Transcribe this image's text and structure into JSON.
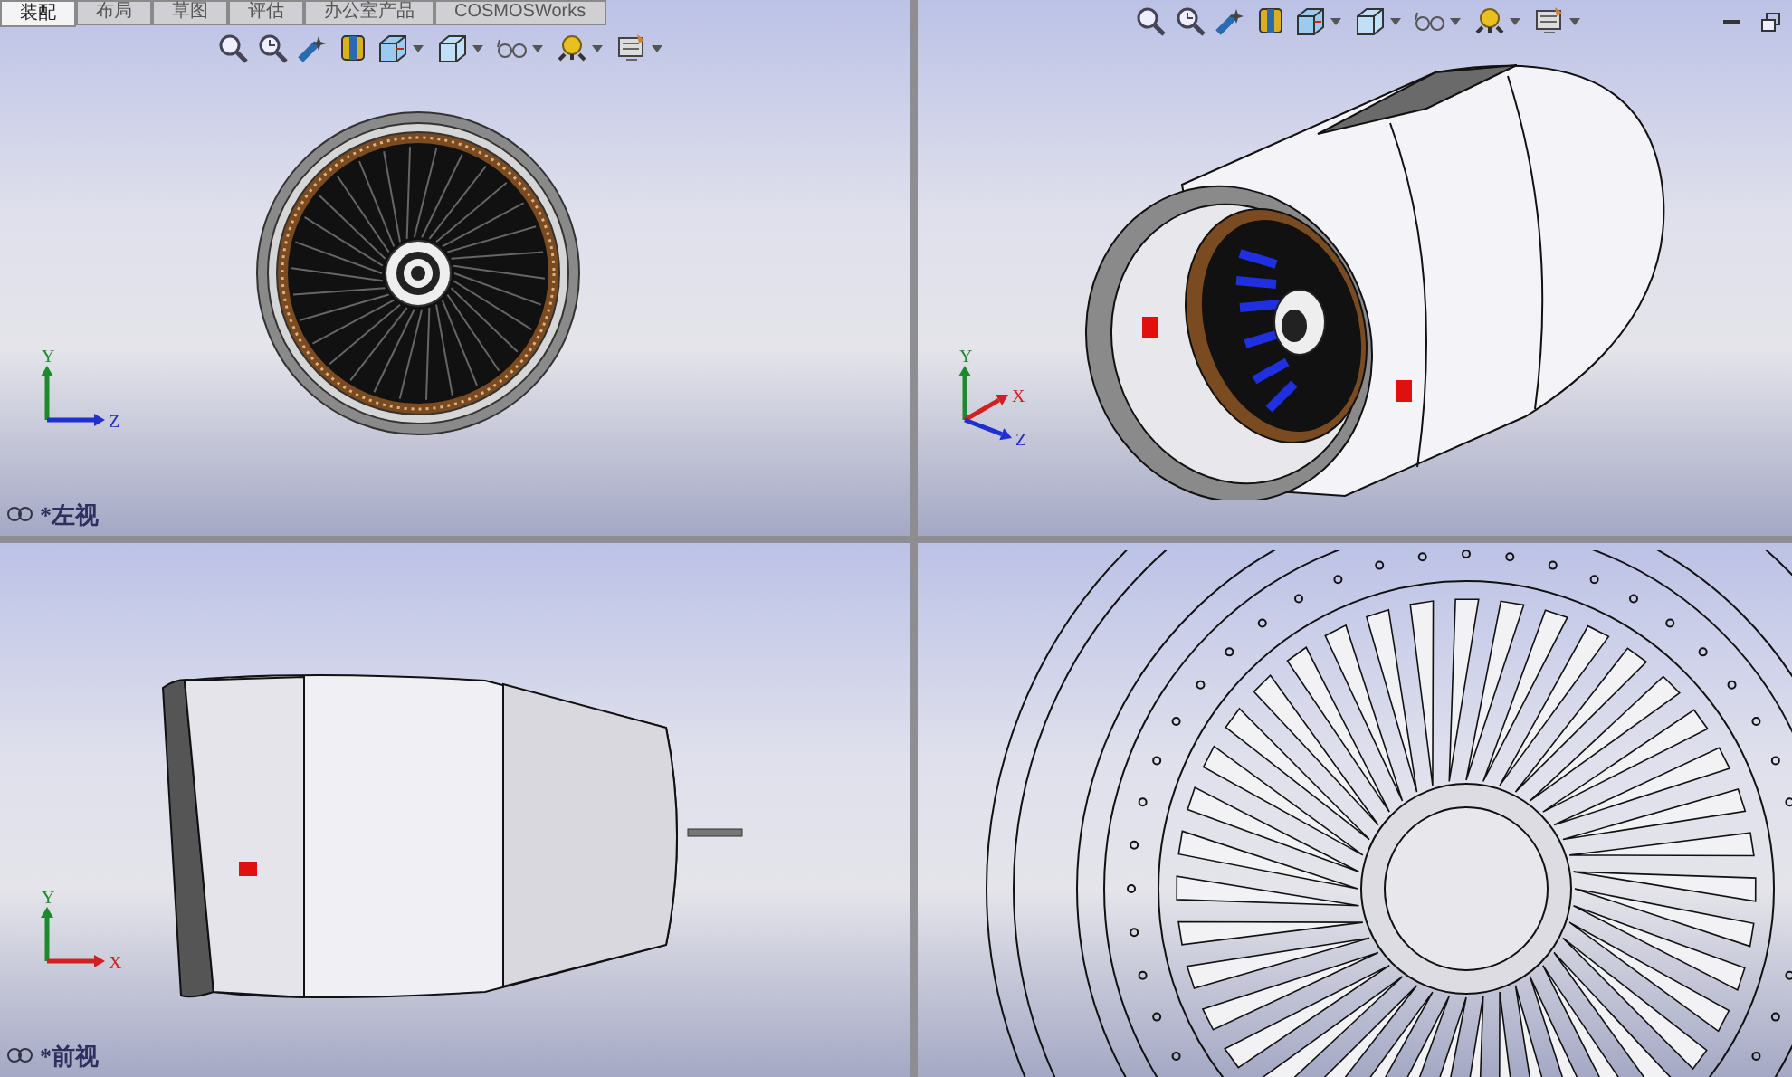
{
  "viewports": [
    {
      "kind": "left-view",
      "tabs": [
        {
          "label": "装配",
          "selected": true
        },
        {
          "label": "布局",
          "selected": false
        },
        {
          "label": "草图",
          "selected": false
        },
        {
          "label": "评估",
          "selected": false
        },
        {
          "label": "办公室产品",
          "selected": false
        },
        {
          "label": "COSMOSWorks",
          "selected": false
        }
      ],
      "label": "*左视",
      "axes": [
        {
          "label": "Y",
          "color": "#1c8a2c"
        },
        {
          "label": "Z",
          "color": "#2030d0"
        }
      ]
    },
    {
      "kind": "isometric-view",
      "axes": [
        {
          "label": "Y",
          "color": "#1c8a2c"
        },
        {
          "label": "X",
          "color": "#d02020"
        },
        {
          "label": "Z",
          "color": "#2030d0"
        }
      ]
    },
    {
      "kind": "front-view",
      "label": "*前视",
      "axes": [
        {
          "label": "Y",
          "color": "#1c8a2c"
        },
        {
          "label": "X",
          "color": "#d02020"
        }
      ]
    },
    {
      "kind": "wireframe-closeup"
    }
  ]
}
